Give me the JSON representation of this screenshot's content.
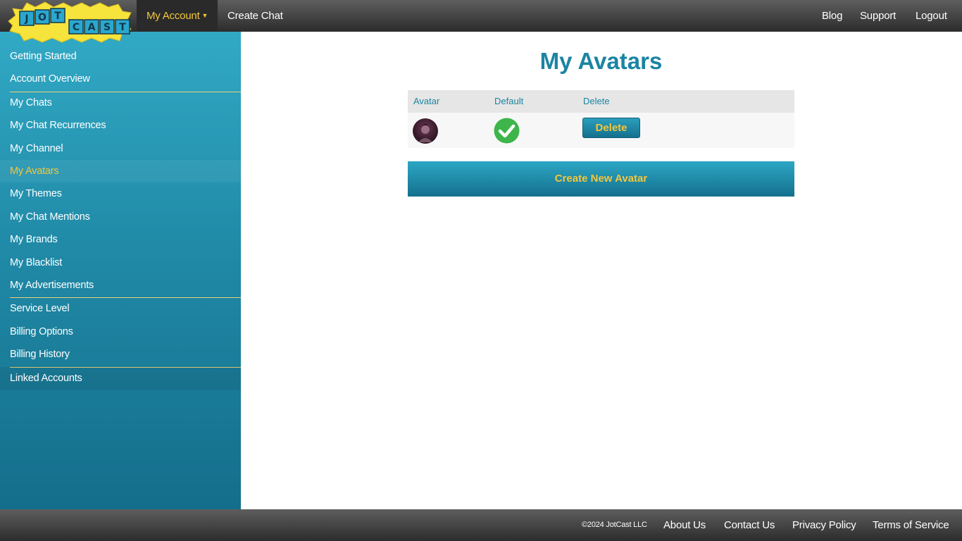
{
  "logo": {
    "letters_top": [
      "J",
      "O",
      "T"
    ],
    "letters_bottom": [
      "C",
      "A",
      "S",
      "T"
    ]
  },
  "topnav": {
    "my_account": "My Account",
    "create_chat": "Create Chat",
    "blog": "Blog",
    "support": "Support",
    "logout": "Logout"
  },
  "sidebar": {
    "items": [
      {
        "label": "Getting Started"
      },
      {
        "label": "Account Overview"
      },
      {
        "label": "My Chats"
      },
      {
        "label": "My Chat Recurrences"
      },
      {
        "label": "My Channel"
      },
      {
        "label": "My Avatars",
        "active": true
      },
      {
        "label": "My Themes"
      },
      {
        "label": "My Chat Mentions"
      },
      {
        "label": "My Brands"
      },
      {
        "label": "My Blacklist"
      },
      {
        "label": "My Advertisements"
      },
      {
        "label": "Service Level"
      },
      {
        "label": "Billing Options"
      },
      {
        "label": "Billing History"
      },
      {
        "label": "Linked Accounts"
      }
    ]
  },
  "main": {
    "title": "My Avatars",
    "table": {
      "headers": {
        "avatar": "Avatar",
        "default": "Default",
        "delete": "Delete"
      },
      "rows": [
        {
          "is_default": true,
          "delete_label": "Delete"
        }
      ]
    },
    "create_button": "Create New Avatar"
  },
  "footer": {
    "copyright": "©2024 JotCast LLC",
    "about": "About Us",
    "contact": "Contact Us",
    "privacy": "Privacy Policy",
    "terms": "Terms of Service"
  },
  "colors": {
    "accent": "#1b84a2",
    "highlight": "#f4c63d",
    "check_green": "#3db54a",
    "logo_yellow": "#f6e33b",
    "logo_blue": "#29a8cf"
  }
}
